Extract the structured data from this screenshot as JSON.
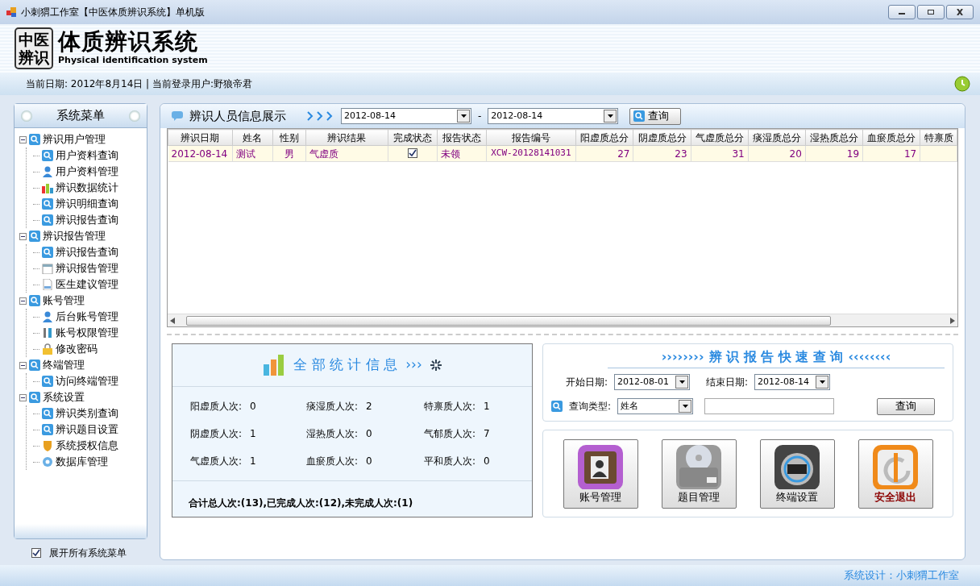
{
  "window": {
    "title": "小刺猬工作室【中医体质辨识系统】单机版"
  },
  "header": {
    "logo_lines": [
      "中医",
      "辨识"
    ],
    "title": "体质辨识系统",
    "subtitle": "Physical identification system"
  },
  "info_bar": {
    "text": "当前日期: 2012年8月14日 | 当前登录用户:野狼帝君"
  },
  "sidebar": {
    "title": "系统菜单",
    "items": [
      {
        "label": "辨识用户管理",
        "kind": "search",
        "expanded": true,
        "children": [
          {
            "label": "用户资料查询",
            "kind": "search"
          },
          {
            "label": "用户资料管理",
            "kind": "user"
          },
          {
            "label": "辨识数据统计",
            "kind": "chart"
          },
          {
            "label": "辨识明细查询",
            "kind": "search"
          },
          {
            "label": "辨识报告查询",
            "kind": "search"
          }
        ]
      },
      {
        "label": "辨识报告管理",
        "kind": "search",
        "expanded": true,
        "children": [
          {
            "label": "辨识报告查询",
            "kind": "search"
          },
          {
            "label": "辨识报告管理",
            "kind": "calendar"
          },
          {
            "label": "医生建议管理",
            "kind": "document"
          }
        ]
      },
      {
        "label": "账号管理",
        "kind": "search",
        "expanded": true,
        "children": [
          {
            "label": "后台账号管理",
            "kind": "user"
          },
          {
            "label": "账号权限管理",
            "kind": "tools"
          },
          {
            "label": "修改密码",
            "kind": "lock"
          }
        ]
      },
      {
        "label": "终端管理",
        "kind": "search",
        "expanded": true,
        "children": [
          {
            "label": "访问终端管理",
            "kind": "search"
          }
        ]
      },
      {
        "label": "系统设置",
        "kind": "search",
        "expanded": true,
        "children": [
          {
            "label": "辨识类别查询",
            "kind": "search"
          },
          {
            "label": "辨识题目设置",
            "kind": "search"
          },
          {
            "label": "系统授权信息",
            "kind": "shield"
          },
          {
            "label": "数据库管理",
            "kind": "gear"
          }
        ]
      }
    ],
    "expand_all": {
      "label": "展开所有系统菜单",
      "checked": true
    }
  },
  "records": {
    "title": "辨识人员信息展示",
    "date_from": "2012-08-14",
    "separator": "-",
    "date_to": "2012-08-14",
    "button": "查询",
    "columns": [
      "辨识日期",
      "姓名",
      "性别",
      "辨识结果",
      "完成状态",
      "报告状态",
      "报告编号",
      "阳虚质总分",
      "阴虚质总分",
      "气虚质总分",
      "痰湿质总分",
      "湿热质总分",
      "血瘀质总分",
      "特禀质"
    ],
    "rows": [
      {
        "selected": true,
        "date": "2012-08-14",
        "name": "测试",
        "gender": "男",
        "result": "气虚质",
        "completed": true,
        "report_status": "未领",
        "report_no": "XCW-20128141031",
        "scores": [
          "27",
          "23",
          "31",
          "20",
          "19",
          "17"
        ]
      }
    ]
  },
  "stats": {
    "title": "全 部 统 计 信 息",
    "arrows": "›››",
    "items": [
      {
        "label": "阳虚质人次:",
        "value": "0"
      },
      {
        "label": "痰湿质人次:",
        "value": "2"
      },
      {
        "label": "特禀质人次:",
        "value": "1"
      },
      {
        "label": "阴虚质人次:",
        "value": "1"
      },
      {
        "label": "湿热质人次:",
        "value": "0"
      },
      {
        "label": "气郁质人次:",
        "value": "7"
      },
      {
        "label": "气虚质人次:",
        "value": "1"
      },
      {
        "label": "血瘀质人次:",
        "value": "0"
      },
      {
        "label": "平和质人次:",
        "value": "0"
      }
    ],
    "summary": "合计总人次:(13),已完成人次:(12),未完成人次:(1)"
  },
  "quick_query": {
    "arrows_left": "››››››››",
    "title": "辨 识 报 告 快 速 查 询",
    "arrows_right": "‹‹‹‹‹‹‹‹",
    "start_label": "开始日期:",
    "start": "2012-08-01",
    "end_label": "结束日期:",
    "end": "2012-08-14",
    "type_label": "查询类型:",
    "type": "姓名",
    "button": "查询"
  },
  "tiles": [
    {
      "kind": "account",
      "label": "账号管理"
    },
    {
      "kind": "questions",
      "label": "题目管理"
    },
    {
      "kind": "terminal",
      "label": "终端设置"
    },
    {
      "kind": "exit",
      "label": "安全退出"
    }
  ],
  "status_bar": {
    "text": "系统设计：小刺猬工作室"
  }
}
